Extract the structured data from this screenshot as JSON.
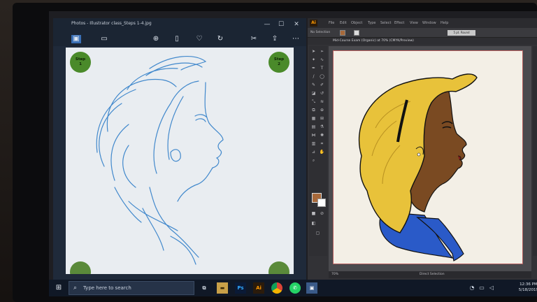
{
  "photos": {
    "title": "Photos - Illustrator class_Steps 1-4.jpg",
    "window_controls": {
      "minimize": "—",
      "maximize": "☐",
      "close": "✕"
    },
    "toolbar_icons": [
      "image-icon",
      "slideshow-icon",
      "zoom-icon",
      "delete-icon",
      "heart-icon",
      "rotate-icon",
      "edit-icon",
      "share-icon",
      "more-icon"
    ],
    "steps": [
      {
        "line1": "Step",
        "line2": "1"
      },
      {
        "line1": "Step",
        "line2": "2"
      }
    ]
  },
  "illustrator": {
    "logo": "Ai",
    "menu": [
      "File",
      "Edit",
      "Object",
      "Type",
      "Select",
      "Effect",
      "View",
      "Window",
      "Help"
    ],
    "control_bar": {
      "selection": "No Selection",
      "style": "5 pt. Round"
    },
    "document_tab": "Mid-Course Exam (Organic) at 70% (CMYK/Preview)",
    "status": {
      "zoom": "70%",
      "tool": "Direct Selection"
    },
    "fill_color": "#a8693a"
  },
  "taskbar": {
    "search_placeholder": "Type here to search",
    "apps": [
      "Ps",
      "Ai"
    ],
    "time": "12:36 PM",
    "date": "5/18/2019"
  },
  "colors": {
    "hair": "#e8c23a",
    "skin": "#7a4a22",
    "shirt": "#2a5ac8",
    "sketch": "#2f7ec8",
    "step_badge": "#4a8a2a"
  }
}
